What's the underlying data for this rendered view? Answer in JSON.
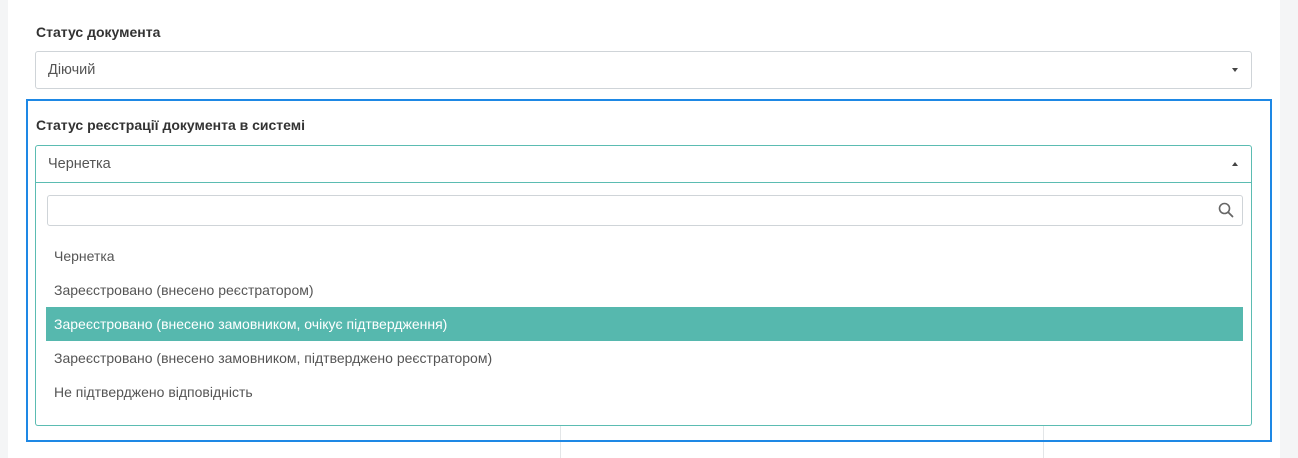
{
  "document_status": {
    "label": "Статус документа",
    "selected": "Діючий"
  },
  "registration_status": {
    "label": "Статус реєстрації документа в системі",
    "selected": "Чернетка",
    "search": {
      "value": "",
      "placeholder": ""
    },
    "options": [
      {
        "label": "Чернетка",
        "highlighted": false
      },
      {
        "label": "Зареєстровано (внесено реєстратором)",
        "highlighted": false
      },
      {
        "label": "Зареєстровано (внесено замовником, очікує підтвердження)",
        "highlighted": true
      },
      {
        "label": "Зареєстровано (внесено замовником, підтверджено реєстратором)",
        "highlighted": false
      },
      {
        "label": "Не підтверджено відповідність",
        "highlighted": false
      }
    ]
  },
  "colors": {
    "focus_border": "#1e88e5",
    "highlight": "#56b8ae",
    "open_select_border": "#5bbcb2"
  },
  "icons": {
    "search": "search-icon",
    "closed_arrow": "chevron-down-icon",
    "open_arrow": "chevron-up-icon"
  }
}
